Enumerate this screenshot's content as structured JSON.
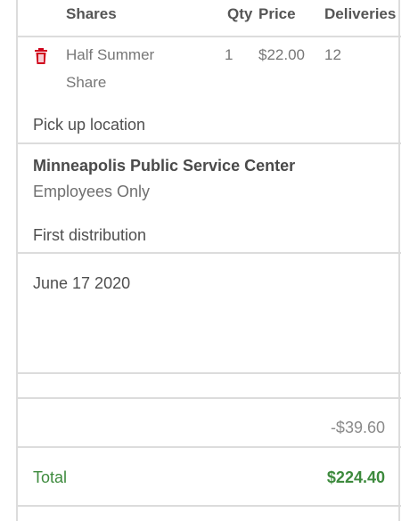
{
  "table": {
    "headers": {
      "shares": "Shares",
      "qty": "Qty",
      "price": "Price",
      "deliveries": "Deliveries"
    },
    "rows": [
      {
        "name_line1": "Half Summer",
        "name_line2": "Share",
        "qty": "1",
        "price": "$22.00",
        "deliveries": "12"
      }
    ]
  },
  "pickup": {
    "label": "Pick up location",
    "location_name": "Minneapolis Public Service Center",
    "location_note": "Employees Only"
  },
  "distribution": {
    "label": "First distribution",
    "date": "June 17 2020"
  },
  "summary": {
    "discount": "-$39.60",
    "total_label": "Total",
    "total_value": "$224.40"
  },
  "colors": {
    "trash_icon": "#d0021b",
    "total": "#3d8a3d"
  },
  "icons": {
    "delete": "trash-icon"
  }
}
